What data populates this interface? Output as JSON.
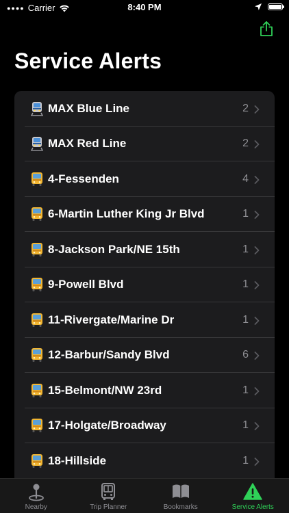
{
  "status_bar": {
    "carrier": "Carrier",
    "time": "8:40 PM",
    "battery_level": 1.0
  },
  "share_icon": "share-icon",
  "title": "Service Alerts",
  "alerts": [
    {
      "name": "MAX Blue Line",
      "count": "2",
      "mode": "train"
    },
    {
      "name": "MAX Red Line",
      "count": "2",
      "mode": "train"
    },
    {
      "name": "4-Fessenden",
      "count": "4",
      "mode": "bus"
    },
    {
      "name": "6-Martin Luther King Jr Blvd",
      "count": "1",
      "mode": "bus"
    },
    {
      "name": "8-Jackson Park/NE 15th",
      "count": "1",
      "mode": "bus"
    },
    {
      "name": "9-Powell Blvd",
      "count": "1",
      "mode": "bus"
    },
    {
      "name": "11-Rivergate/Marine Dr",
      "count": "1",
      "mode": "bus"
    },
    {
      "name": "12-Barbur/Sandy Blvd",
      "count": "6",
      "mode": "bus"
    },
    {
      "name": "15-Belmont/NW 23rd",
      "count": "1",
      "mode": "bus"
    },
    {
      "name": "17-Holgate/Broadway",
      "count": "1",
      "mode": "bus"
    },
    {
      "name": "18-Hillside",
      "count": "1",
      "mode": "bus"
    }
  ],
  "tabs": [
    {
      "label": "Nearby",
      "icon": "map-pin-icon",
      "active": false
    },
    {
      "label": "Trip Planner",
      "icon": "bus-front-icon",
      "active": false
    },
    {
      "label": "Bookmarks",
      "icon": "book-icon",
      "active": false
    },
    {
      "label": "Service Alerts",
      "icon": "warning-triangle-icon",
      "active": true
    }
  ],
  "colors": {
    "accent": "#2fd158",
    "background": "#000000",
    "list_background": "#1c1c1e",
    "secondary_text": "#8e8e93"
  }
}
